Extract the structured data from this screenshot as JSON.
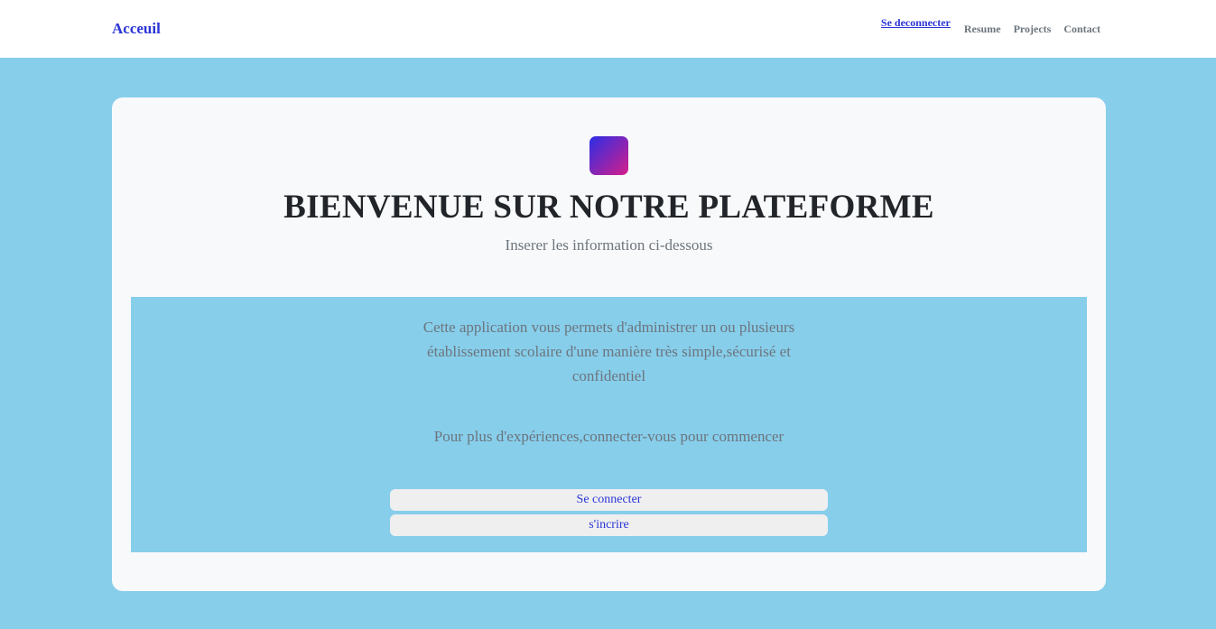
{
  "nav": {
    "brand": "Acceuil",
    "logout": "Se deconnecter",
    "items": [
      "Resume",
      "Projects",
      "Contact"
    ]
  },
  "hero": {
    "title": "BIENVENUE SUR NOTRE PLATEFORME",
    "subtitle": "Inserer les information ci-dessous"
  },
  "info": {
    "description": "Cette application vous permets d'administrer un ou plusieurs établissement scolaire d'une manière très simple,sécurisé et confidentiel",
    "more": "Pour plus d'expériences,connecter-vous pour commencer"
  },
  "buttons": {
    "login": "Se connecter",
    "signup": "s'incrire"
  },
  "colors": {
    "background": "#87ceeb",
    "accent": "#2b35d6",
    "card": "#f8f9fa"
  }
}
